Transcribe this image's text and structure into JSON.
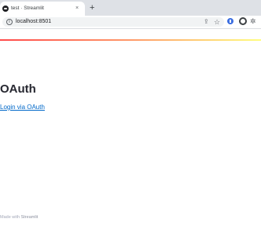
{
  "browser": {
    "tab_title": "test · Streamlit",
    "tab_close": "×",
    "new_tab": "+",
    "url": "localhost:8501",
    "info_glyph": "i",
    "share_glyph": "⇪",
    "star_glyph": "☆",
    "extensions_glyph": "✲"
  },
  "app": {
    "header_colors": [
      "#ff4b4b",
      "#ff9a6a",
      "#fffd80"
    ],
    "title": "OAuth",
    "login_link": "Login via OAuth",
    "link_color": "#0068c9"
  },
  "footer": {
    "prefix": "Made with ",
    "brand": "Streamlit"
  }
}
